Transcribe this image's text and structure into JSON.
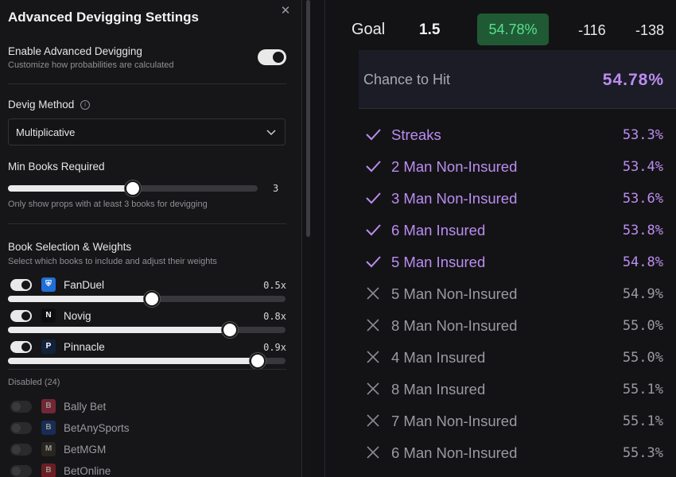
{
  "panel": {
    "title": "Advanced Devigging Settings",
    "close_icon": "close-icon",
    "enable": {
      "label": "Enable Advanced Devigging",
      "description": "Customize how probabilities are calculated",
      "enabled": true
    },
    "devig_method": {
      "label": "Devig Method",
      "info_icon": "info-icon",
      "selected": "Multiplicative",
      "chevron_icon": "chevron-down-icon"
    },
    "min_books": {
      "label": "Min Books Required",
      "value": "3",
      "level_fraction": 0.5,
      "help": "Only show props with at least 3 books for devigging"
    },
    "book_selection": {
      "label": "Book Selection & Weights",
      "description": "Select which books to include and adjust their weights",
      "enabled_books": [
        {
          "name": "FanDuel",
          "weight": "0.5x",
          "level_fraction": 0.5,
          "logo_color": "#1f6fd6",
          "logo_glyph": "⛨"
        },
        {
          "name": "Novig",
          "weight": "0.8x",
          "level_fraction": 0.8,
          "logo_color": "#0e0e10",
          "logo_glyph": "N"
        },
        {
          "name": "Pinnacle",
          "weight": "0.9x",
          "level_fraction": 0.9,
          "logo_color": "#13223b",
          "logo_glyph": "P"
        }
      ],
      "disabled_label": "Disabled (24)",
      "disabled_books": [
        {
          "name": "Bally Bet",
          "logo_color": "#c0364a",
          "logo_glyph": "B"
        },
        {
          "name": "BetAnySports",
          "logo_color": "#1c3f8a",
          "logo_glyph": "B"
        },
        {
          "name": "BetMGM",
          "logo_color": "#3a3326",
          "logo_glyph": "M"
        },
        {
          "name": "BetOnline",
          "logo_color": "#b3232e",
          "logo_glyph": "B"
        }
      ]
    }
  },
  "market": {
    "goal_text": "Goal",
    "line": "1.5",
    "badge": "54.78%",
    "odds_over": "-116",
    "odds_under": "-138"
  },
  "chance": {
    "label": "Chance to Hit",
    "value": "54.78%"
  },
  "entries": [
    {
      "name": "Streaks",
      "pct": "53.3%",
      "included": true
    },
    {
      "name": "2 Man Non-Insured",
      "pct": "53.4%",
      "included": true
    },
    {
      "name": "3 Man Non-Insured",
      "pct": "53.6%",
      "included": true
    },
    {
      "name": "6 Man Insured",
      "pct": "53.8%",
      "included": true
    },
    {
      "name": "5 Man Insured",
      "pct": "54.8%",
      "included": true
    },
    {
      "name": "5 Man Non-Insured",
      "pct": "54.9%",
      "included": false
    },
    {
      "name": "8 Man Non-Insured",
      "pct": "55.0%",
      "included": false
    },
    {
      "name": "4 Man Insured",
      "pct": "55.0%",
      "included": false
    },
    {
      "name": "8 Man Insured",
      "pct": "55.1%",
      "included": false
    },
    {
      "name": "7 Man Non-Insured",
      "pct": "55.1%",
      "included": false
    },
    {
      "name": "6 Man Non-Insured",
      "pct": "55.3%",
      "included": false
    }
  ],
  "colors": {
    "accent_purple": "#bb8df0",
    "badge_green_bg": "#1f5a35",
    "badge_green_text": "#57e08a"
  }
}
